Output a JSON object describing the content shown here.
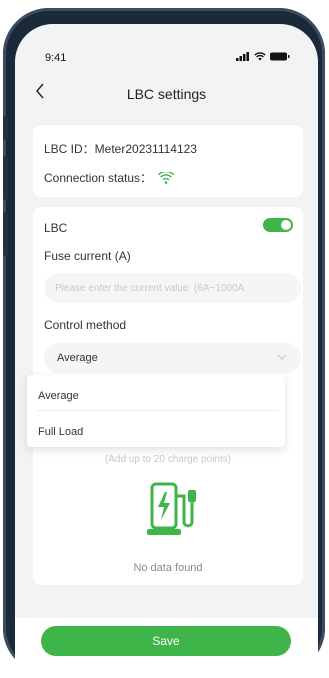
{
  "status_bar": {
    "time": "9:41"
  },
  "nav": {
    "title": "LBC settings"
  },
  "info": {
    "lbc_id": "LBC ID：Meter20231114123",
    "connection_label": "Connection status："
  },
  "lbc": {
    "label": "LBC",
    "toggle_on": true,
    "fuse_label": "Fuse current (A)",
    "fuse_placeholder": "Please enter the current value  (6A~1000A",
    "fuse_value": "",
    "control_label": "Control method",
    "control_value": "Average",
    "options": [
      "Average",
      "Full Load"
    ],
    "hint": "(Add up to 20 charge points)",
    "empty_text": "No data found"
  },
  "footer": {
    "save_label": "Save"
  },
  "colors": {
    "accent": "#3fb449",
    "background": "#f2f3f5",
    "frame": "#1b2a3a"
  }
}
